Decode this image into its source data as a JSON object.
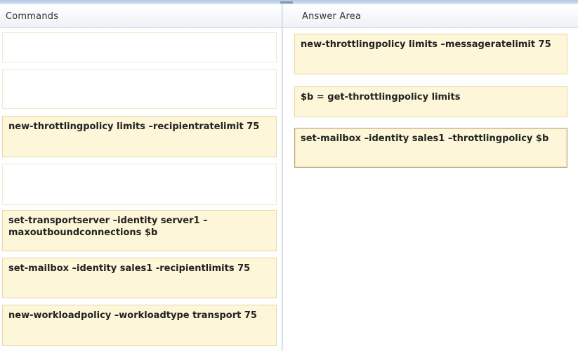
{
  "left_pane": {
    "title": "Commands",
    "tiles": [
      {
        "text": ""
      },
      {
        "text": ""
      },
      {
        "text": "new-throttlingpolicy limits –recipientratelimit 75"
      },
      {
        "text": ""
      },
      {
        "text": "set-transportserver –identity server1 –maxoutboundconnections $b"
      },
      {
        "text": "set-mailbox –identity sales1 -recipientlimits 75"
      },
      {
        "text": "new-workloadpolicy –workloadtype transport 75"
      }
    ]
  },
  "right_pane": {
    "title": "Answer Area",
    "tiles": [
      {
        "text": "new-throttlingpolicy limits –messageratelimit 75"
      },
      {
        "text": "$b = get-throttlingpolicy limits"
      },
      {
        "text": "set-mailbox –identity sales1 –throttlingpolicy $b"
      }
    ]
  }
}
